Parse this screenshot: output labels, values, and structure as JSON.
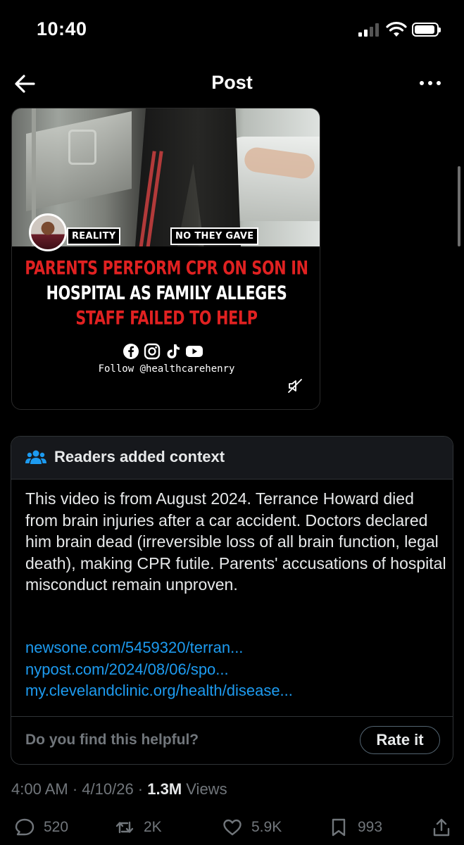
{
  "status_bar": {
    "time": "10:40"
  },
  "header": {
    "title": "Post"
  },
  "media": {
    "chip_left": "REALITY",
    "chip_right": "NO THEY GAVE",
    "headline_line1": "PARENTS PERFORM CPR ON SON IN",
    "headline_line2": "HOSPITAL AS FAMILY ALLEGES",
    "headline_line3": "STAFF FAILED TO HELP",
    "follow": "Follow @healthcarehenry"
  },
  "context": {
    "title": "Readers added context",
    "body": "This video is from August 2024. Terrance Howard died from brain injuries after a car accident. Doctors declared him brain dead (irreversible loss of all brain function, legal death), making CPR futile. Parents' accusations of hospital misconduct remain unproven.",
    "links": [
      "newsone.com/5459320/terran...",
      "nypost.com/2024/08/06/spo...",
      "my.clevelandclinic.org/health/disease..."
    ],
    "helpful_question": "Do you find this helpful?",
    "rate_label": "Rate it"
  },
  "meta": {
    "time": "4:00 AM",
    "sep1": " · ",
    "date": "4/10/26",
    "sep2": " · ",
    "views_count": "1.3M",
    "views_label": " Views"
  },
  "actions": {
    "replies": "520",
    "reposts": "2K",
    "likes": "5.9K",
    "bookmarks": "993"
  },
  "colors": {
    "background": "#000000",
    "link": "#1d9bf0",
    "muted": "#71767b",
    "headline_red": "#e02121",
    "context_header_bg": "#16181c"
  },
  "icons": [
    "back-arrow-icon",
    "more-icon",
    "people-icon",
    "facebook-icon",
    "instagram-icon",
    "tiktok-icon",
    "youtube-icon",
    "muted-speaker-icon",
    "reply-icon",
    "repost-icon",
    "like-icon",
    "bookmark-icon",
    "share-icon"
  ]
}
